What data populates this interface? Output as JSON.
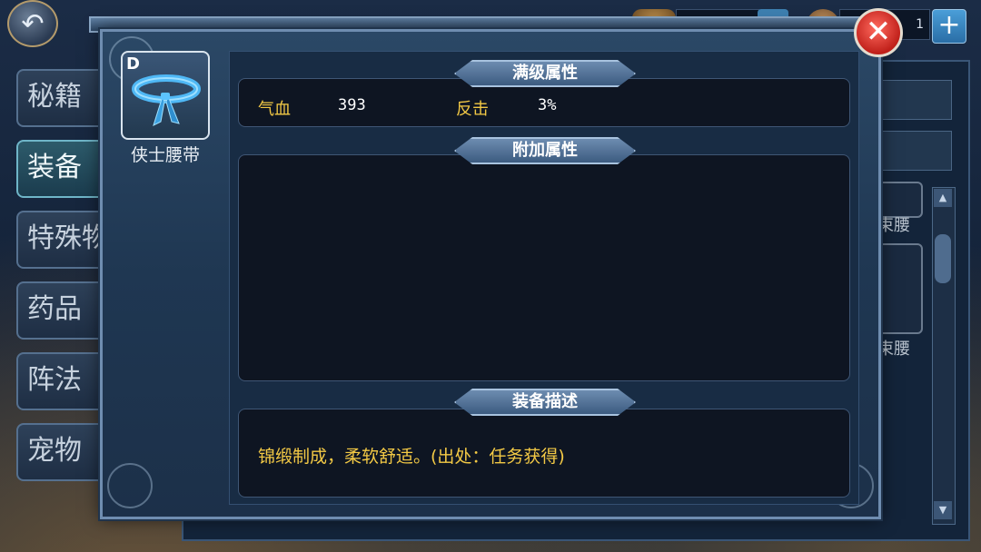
{
  "sidebar": {
    "tabs": [
      {
        "label": "秘籍",
        "active": false
      },
      {
        "label": "装备",
        "active": true
      },
      {
        "label": "特殊物品",
        "active": false
      },
      {
        "label": "药品",
        "active": false
      },
      {
        "label": "阵法",
        "active": false
      },
      {
        "label": "宠物",
        "active": false
      }
    ]
  },
  "topbar": {
    "resource_value": "1"
  },
  "background_list": {
    "item_label_1": "束腰",
    "item_label_2": "束腰"
  },
  "item": {
    "grade": "D",
    "name": "侠士腰带",
    "icon": "blue-belt-icon"
  },
  "sections": {
    "max_attributes_title": "满级属性",
    "extra_attributes_title": "附加属性",
    "description_title": "装备描述"
  },
  "max_attributes": [
    {
      "name": "气血",
      "value": "393"
    },
    {
      "name": "反击",
      "value": "3%"
    }
  ],
  "description": "锦缎制成，柔软舒适。(出处：任务获得)",
  "colors": {
    "attr_name": "#f3c945",
    "close_button": "#d42a22",
    "accent_blue": "#3d7fb0"
  }
}
